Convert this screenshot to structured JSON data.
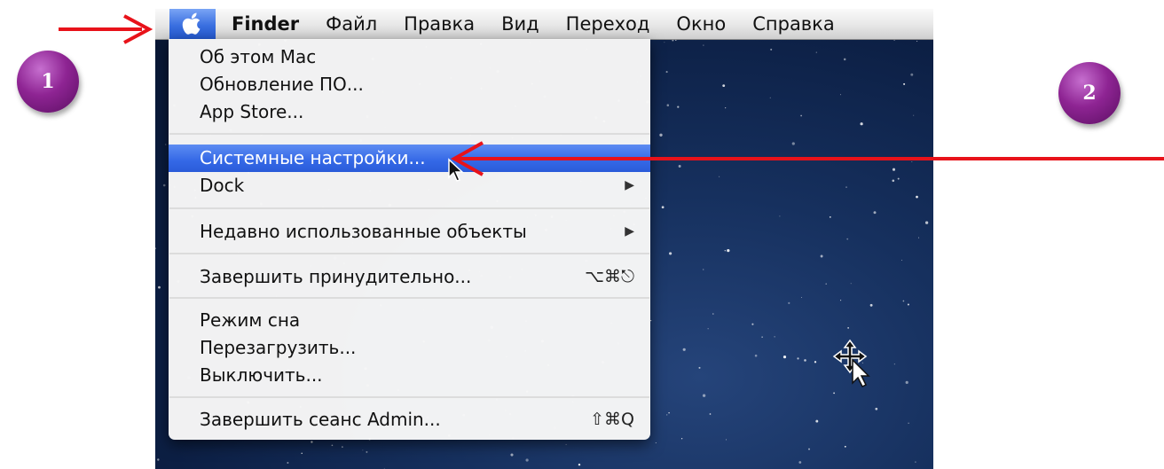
{
  "menubar": {
    "apple_label": "",
    "app_name": "Finder",
    "items": [
      "Файл",
      "Правка",
      "Вид",
      "Переход",
      "Окно",
      "Справка"
    ]
  },
  "apple_menu": {
    "items": [
      {
        "label": "Об этом Mac"
      },
      {
        "label": "Обновление ПО..."
      },
      {
        "label": "App Store..."
      },
      {
        "label": "Системные настройки...",
        "highlighted": true
      },
      {
        "label": "Dock",
        "submenu": "▶"
      },
      {
        "label": "Недавно использованные объекты",
        "submenu": "▶"
      },
      {
        "label": "Завершить принудительно...",
        "shortcut": "⌥⌘⎋"
      },
      {
        "label": "Режим сна"
      },
      {
        "label": "Перезагрузить..."
      },
      {
        "label": "Выключить..."
      },
      {
        "label": "Завершить сеанс Admin...",
        "shortcut": "⇧⌘Q"
      }
    ]
  },
  "annotations": {
    "badge_1": "1",
    "badge_2": "2"
  },
  "colors": {
    "highlight": "#3468e6",
    "annotation_arrow": "#e8121a",
    "badge": "#8e2493",
    "desktop": "#16305e"
  },
  "icons": [
    "apple-logo-icon",
    "submenu-arrow-icon",
    "mouse-pointer-icon",
    "move-cursor-icon"
  ]
}
